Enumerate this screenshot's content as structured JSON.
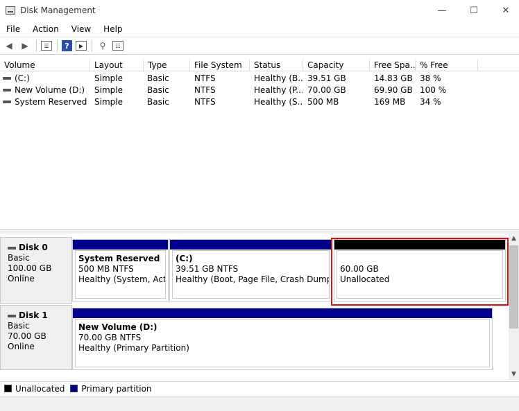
{
  "window": {
    "title": "Disk Management",
    "minimize": "—",
    "maximize": "☐",
    "close": "✕"
  },
  "menu": [
    "File",
    "Action",
    "View",
    "Help"
  ],
  "toolbar": {
    "help_label": "?"
  },
  "volume_list": {
    "columns": [
      "Volume",
      "Layout",
      "Type",
      "File System",
      "Status",
      "Capacity",
      "Free Spa...",
      "% Free"
    ],
    "rows": [
      [
        "(C:)",
        "Simple",
        "Basic",
        "NTFS",
        "Healthy (B...",
        "39.51 GB",
        "14.83 GB",
        "38 %"
      ],
      [
        "New Volume (D:)",
        "Simple",
        "Basic",
        "NTFS",
        "Healthy (P...",
        "70.00 GB",
        "69.90 GB",
        "100 %"
      ],
      [
        "System Reserved",
        "Simple",
        "Basic",
        "NTFS",
        "Healthy (S...",
        "500 MB",
        "169 MB",
        "34 %"
      ]
    ]
  },
  "disks": [
    {
      "name": "Disk 0",
      "type": "Basic",
      "size": "100.00 GB",
      "status": "Online",
      "partitions": [
        {
          "title": "System Reserved",
          "size": "500 MB NTFS",
          "status": "Healthy (System, Active"
        },
        {
          "title": "(C:)",
          "size": "39.51 GB NTFS",
          "status": "Healthy (Boot, Page File, Crash Dump, Prir"
        },
        {
          "size": "60.00 GB",
          "status": "Unallocated"
        }
      ]
    },
    {
      "name": "Disk 1",
      "type": "Basic",
      "size": "70.00 GB",
      "status": "Online",
      "partitions": [
        {
          "title": "New Volume  (D:)",
          "size": "70.00 GB NTFS",
          "status": "Healthy (Primary Partition)"
        }
      ]
    }
  ],
  "legend": {
    "unallocated": "Unallocated",
    "primary": "Primary partition"
  },
  "colors": {
    "primary_partition": "#00008a",
    "unallocated": "#000000",
    "highlight": "#e01010"
  }
}
